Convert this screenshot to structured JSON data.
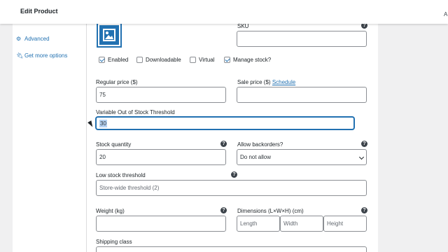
{
  "header": {
    "title": "Edit Product",
    "edge_char": "A"
  },
  "sidebar": {
    "items": [
      {
        "icon": "gear-icon",
        "label": "Advanced"
      },
      {
        "icon": "plug-icon",
        "label": "Get more options"
      }
    ]
  },
  "product_image": {
    "icon": "image-placeholder-icon"
  },
  "sku": {
    "label": "SKU",
    "value": ""
  },
  "options": {
    "enabled": {
      "label": "Enabled",
      "checked": true
    },
    "downloadable": {
      "label": "Downloadable",
      "checked": false
    },
    "virtual": {
      "label": "Virtual",
      "checked": false
    },
    "manage_stock": {
      "label": "Manage stock?",
      "checked": true
    }
  },
  "pricing": {
    "regular_label": "Regular price ($)",
    "regular_value": "75",
    "sale_label": "Sale price ($)",
    "schedule_link": "Schedule",
    "sale_value": ""
  },
  "threshold": {
    "label": "Variable Out of Stock Threshold",
    "value": "30"
  },
  "stock": {
    "quantity_label": "Stock quantity",
    "quantity_value": "20",
    "backorders_label": "Allow backorders?",
    "backorders_value": "Do not allow"
  },
  "low_stock": {
    "label": "Low stock threshold",
    "placeholder": "Store-wide threshold (2)"
  },
  "shipping": {
    "weight_label": "Weight (kg)",
    "weight_value": "",
    "dimensions_label": "Dimensions (L×W×H) (cm)",
    "length_placeholder": "Length",
    "width_placeholder": "Width",
    "height_placeholder": "Height",
    "class_label": "Shipping class"
  },
  "help_glyph": "?"
}
